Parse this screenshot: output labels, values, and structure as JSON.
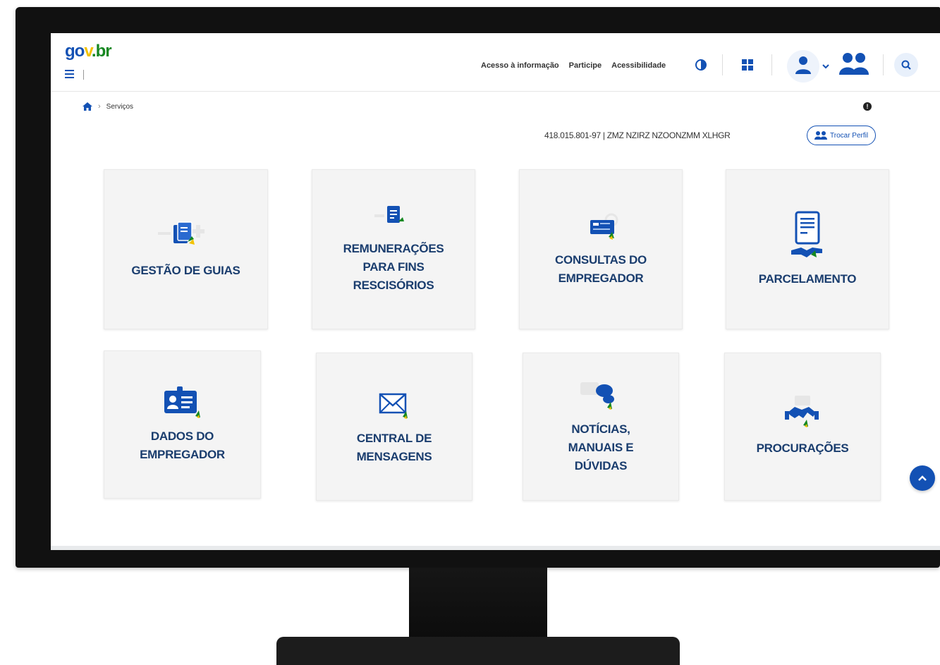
{
  "header": {
    "logo": {
      "part1": "go",
      "part2": "v",
      "part3": ".br"
    },
    "links": [
      "Acesso à informação",
      "Participe",
      "Acessibilidade"
    ]
  },
  "breadcrumb": {
    "current": "Serviços"
  },
  "user": {
    "id_line": "418.015.801-97 | ZMZ NZIRZ NZOONZMM XLHGR",
    "switch_profile_label": "Trocar Perfil"
  },
  "cards": [
    {
      "title": "GESTÃO DE GUIAS",
      "icon": "guide-document-icon"
    },
    {
      "title": "REMUNERAÇÕES\nPARA FINS\nRESCISÓRIOS",
      "icon": "payment-document-icon"
    },
    {
      "title": "CONSULTAS DO\nEMPREGADOR",
      "icon": "search-card-icon"
    },
    {
      "title": "PARCELAMENTO",
      "icon": "installment-document-icon"
    },
    {
      "title": "DADOS DO\nEMPREGADOR",
      "icon": "employer-id-icon"
    },
    {
      "title": "CENTRAL DE\nMENSAGENS",
      "icon": "envelope-icon"
    },
    {
      "title": "NOTÍCIAS,\nMANUAIS E\nDÚVIDAS",
      "icon": "chat-bubbles-icon"
    },
    {
      "title": "PROCURAÇÕES",
      "icon": "handshake-icon"
    }
  ],
  "colors": {
    "primary": "#1351b4",
    "card_text": "#1a3d6e",
    "card_bg": "#f4f4f4",
    "green_accent": "#168821"
  }
}
